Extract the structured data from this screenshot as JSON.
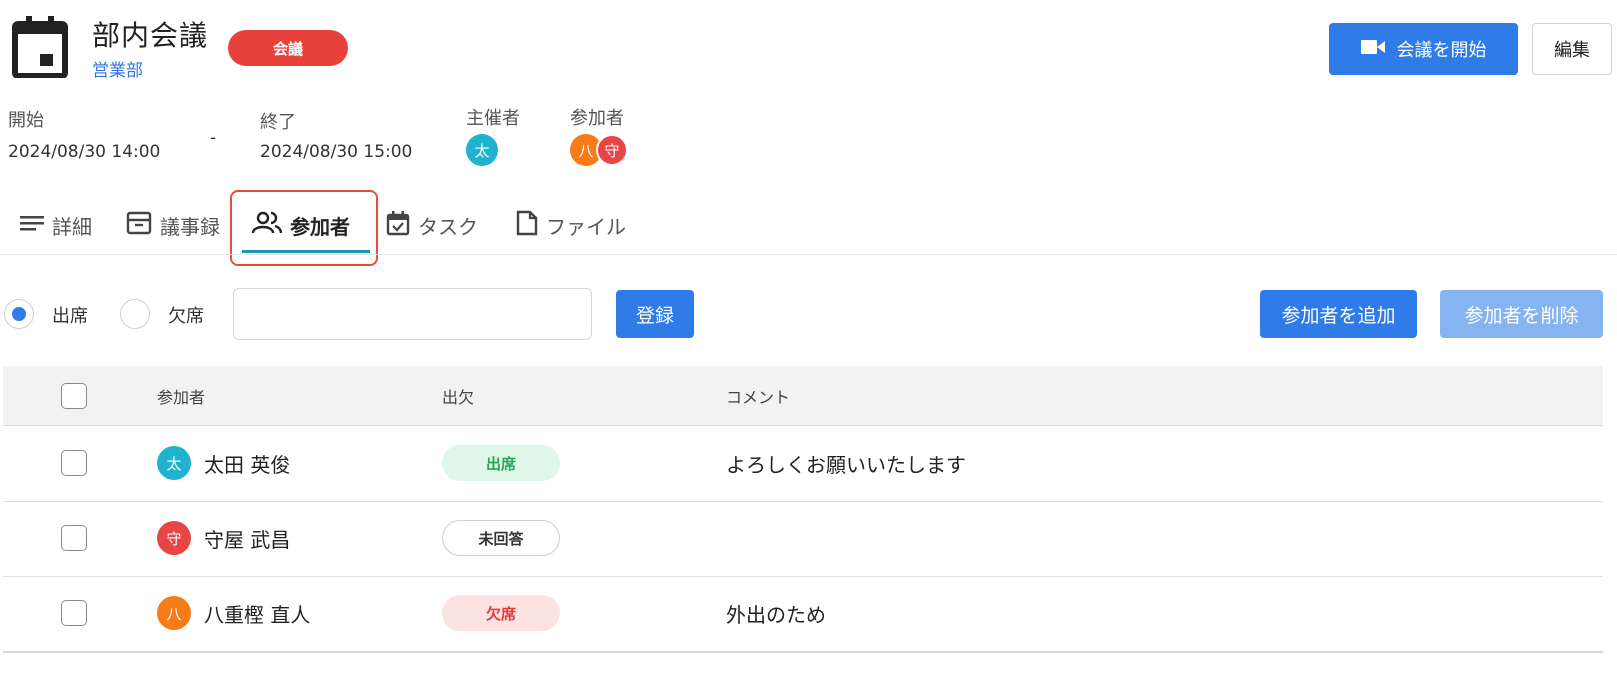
{
  "header": {
    "title": "部内会議",
    "department": "営業部",
    "category_badge": "会議",
    "start_button": "会議を開始",
    "edit_button": "編集"
  },
  "meta": {
    "start_label": "開始",
    "start_value": "2024/08/30 14:00",
    "separator": "-",
    "end_label": "終了",
    "end_value": "2024/08/30 15:00",
    "organizer_label": "主催者",
    "organizer_avatar": "太",
    "participants_label": "参加者",
    "participant_avatars": [
      "八",
      "守"
    ]
  },
  "tabs": [
    {
      "label": "詳細",
      "icon": "lines-icon"
    },
    {
      "label": "議事録",
      "icon": "archive-icon"
    },
    {
      "label": "参加者",
      "icon": "people-icon",
      "active": true
    },
    {
      "label": "タスク",
      "icon": "calendar-check-icon"
    },
    {
      "label": "ファイル",
      "icon": "file-icon"
    }
  ],
  "controls": {
    "attend_label": "出席",
    "absent_label": "欠席",
    "selected": "出席",
    "comment_value": "",
    "register_button": "登録",
    "add_button": "参加者を追加",
    "delete_button": "参加者を削除"
  },
  "table": {
    "headers": {
      "participant": "参加者",
      "attendance": "出欠",
      "comment": "コメント"
    },
    "rows": [
      {
        "avatar": "太",
        "name": "太田 英俊",
        "status": "出席",
        "comment": "よろしくお願いいたします"
      },
      {
        "avatar": "守",
        "name": "守屋 武昌",
        "status": "未回答",
        "comment": ""
      },
      {
        "avatar": "八",
        "name": "八重樫 直人",
        "status": "欠席",
        "comment": "外出のため"
      }
    ]
  },
  "colors": {
    "primary": "#2f7be8",
    "primary_disabled": "#86b4f0",
    "badge_red": "#e8403a",
    "tab_underline": "#1f97a8",
    "highlight_border": "#e84a3b"
  }
}
